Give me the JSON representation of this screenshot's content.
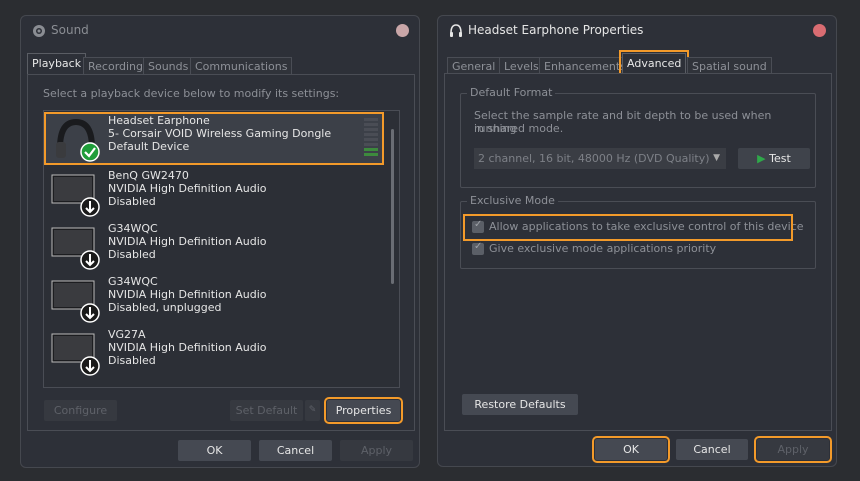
{
  "sound_window": {
    "title": "Sound",
    "tabs": [
      {
        "label": "Playback"
      },
      {
        "label": "Recording"
      },
      {
        "label": "Sounds"
      },
      {
        "label": "Communications"
      }
    ],
    "instruction": "Select a playback device below to modify its settings:",
    "devices": [
      {
        "name": "Headset Earphone",
        "description": "5- Corsair VOID Wireless Gaming Dongle",
        "status": "Default Device"
      },
      {
        "name": "BenQ GW2470",
        "description": "NVIDIA High Definition Audio",
        "status": "Disabled"
      },
      {
        "name": "G34WQC",
        "description": "NVIDIA High Definition Audio",
        "status": "Disabled"
      },
      {
        "name": "G34WQC",
        "description": "NVIDIA High Definition Audio",
        "status": "Disabled, unplugged"
      },
      {
        "name": "VG27A",
        "description": "NVIDIA High Definition Audio",
        "status": "Disabled"
      }
    ],
    "buttons": {
      "configure": "Configure",
      "set_default": "Set Default",
      "properties": "Properties",
      "ok": "OK",
      "cancel": "Cancel",
      "apply": "Apply"
    }
  },
  "props_window": {
    "title": "Headset Earphone Properties",
    "tabs": [
      {
        "label": "General"
      },
      {
        "label": "Levels"
      },
      {
        "label": "Enhancements"
      },
      {
        "label": "Advanced"
      },
      {
        "label": "Spatial sound"
      }
    ],
    "default_format": {
      "label": "Default Format",
      "description_line1": "Select the sample rate and bit depth to be used when running",
      "description_line2": "in shared mode.",
      "selected_format": "2 channel, 16 bit, 48000 Hz (DVD Quality)",
      "test_label": "Test"
    },
    "exclusive_mode": {
      "label": "Exclusive Mode",
      "option1": "Allow applications to take exclusive control of this device",
      "option2": "Give exclusive mode applications priority"
    },
    "buttons": {
      "restore": "Restore Defaults",
      "ok": "OK",
      "cancel": "Cancel",
      "apply": "Apply"
    }
  },
  "colors": {
    "highlight": "#f39a2a",
    "window_bg": "#2d3038",
    "default_check": "#1f9d3a"
  }
}
